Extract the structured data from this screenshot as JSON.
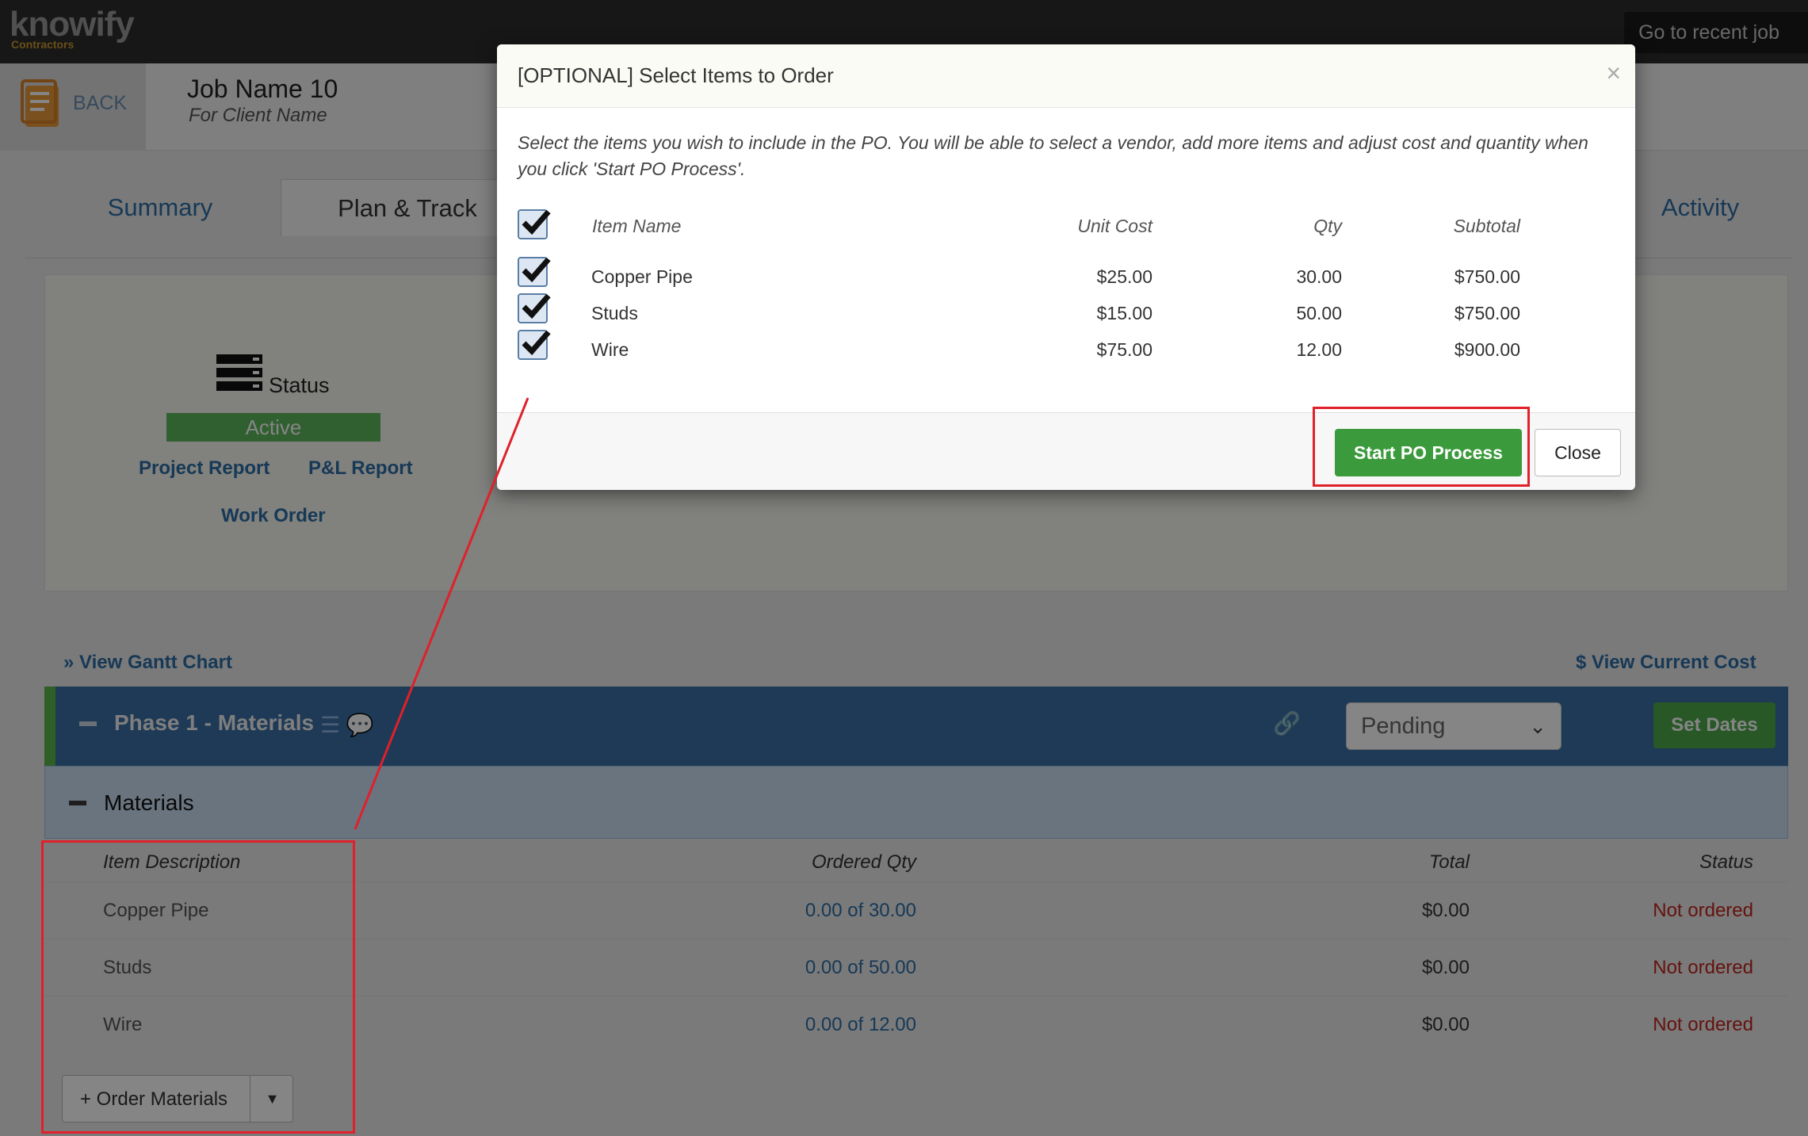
{
  "app": {
    "logo": "knowify",
    "logo_sub": "Contractors"
  },
  "topbar": {
    "recent_job": "Go to recent job"
  },
  "job": {
    "back": "BACK",
    "title": "Job Name 10",
    "client": "For Client Name"
  },
  "tabs": {
    "summary": "Summary",
    "plan": "Plan & Track",
    "activity": "Activity"
  },
  "status_panel": {
    "label": "Status",
    "value": "Active",
    "project_report": "Project Report",
    "pl_report": "P&L Report",
    "work_order": "Work Order"
  },
  "links": {
    "gantt": "View Gantt Chart",
    "cost": "View Current Cost"
  },
  "phase": {
    "title": "Phase 1 - Materials",
    "status": "Pending",
    "set_dates": "Set Dates"
  },
  "materials": {
    "title": "Materials",
    "headers": {
      "desc": "Item Description",
      "qty": "Ordered Qty",
      "total": "Total",
      "status": "Status"
    },
    "rows": [
      {
        "desc": "Copper Pipe",
        "qty": "0.00 of 30.00",
        "total": "$0.00",
        "status": "Not ordered"
      },
      {
        "desc": "Studs",
        "qty": "0.00 of 50.00",
        "total": "$0.00",
        "status": "Not ordered"
      },
      {
        "desc": "Wire",
        "qty": "0.00 of 12.00",
        "total": "$0.00",
        "status": "Not ordered"
      }
    ],
    "order_button": "+ Order Materials"
  },
  "modal": {
    "title": "[OPTIONAL] Select Items to Order",
    "description": "Select the items you wish to include in the PO. You will be able to select a vendor, add more items and adjust cost and quantity when you click 'Start PO Process'.",
    "headers": {
      "name": "Item Name",
      "cost": "Unit Cost",
      "qty": "Qty",
      "subtotal": "Subtotal"
    },
    "rows": [
      {
        "name": "Copper Pipe",
        "cost": "$25.00",
        "qty": "30.00",
        "subtotal": "$750.00",
        "checked": true
      },
      {
        "name": "Studs",
        "cost": "$15.00",
        "qty": "50.00",
        "subtotal": "$750.00",
        "checked": true
      },
      {
        "name": "Wire",
        "cost": "$75.00",
        "qty": "12.00",
        "subtotal": "$900.00",
        "checked": true
      }
    ],
    "start_button": "Start PO Process",
    "close_button": "Close",
    "close_icon": "×"
  },
  "colors": {
    "accent": "#2d6ea6",
    "success": "#3b9a3c",
    "danger": "#c0261d",
    "annotation": "#e0202a"
  }
}
